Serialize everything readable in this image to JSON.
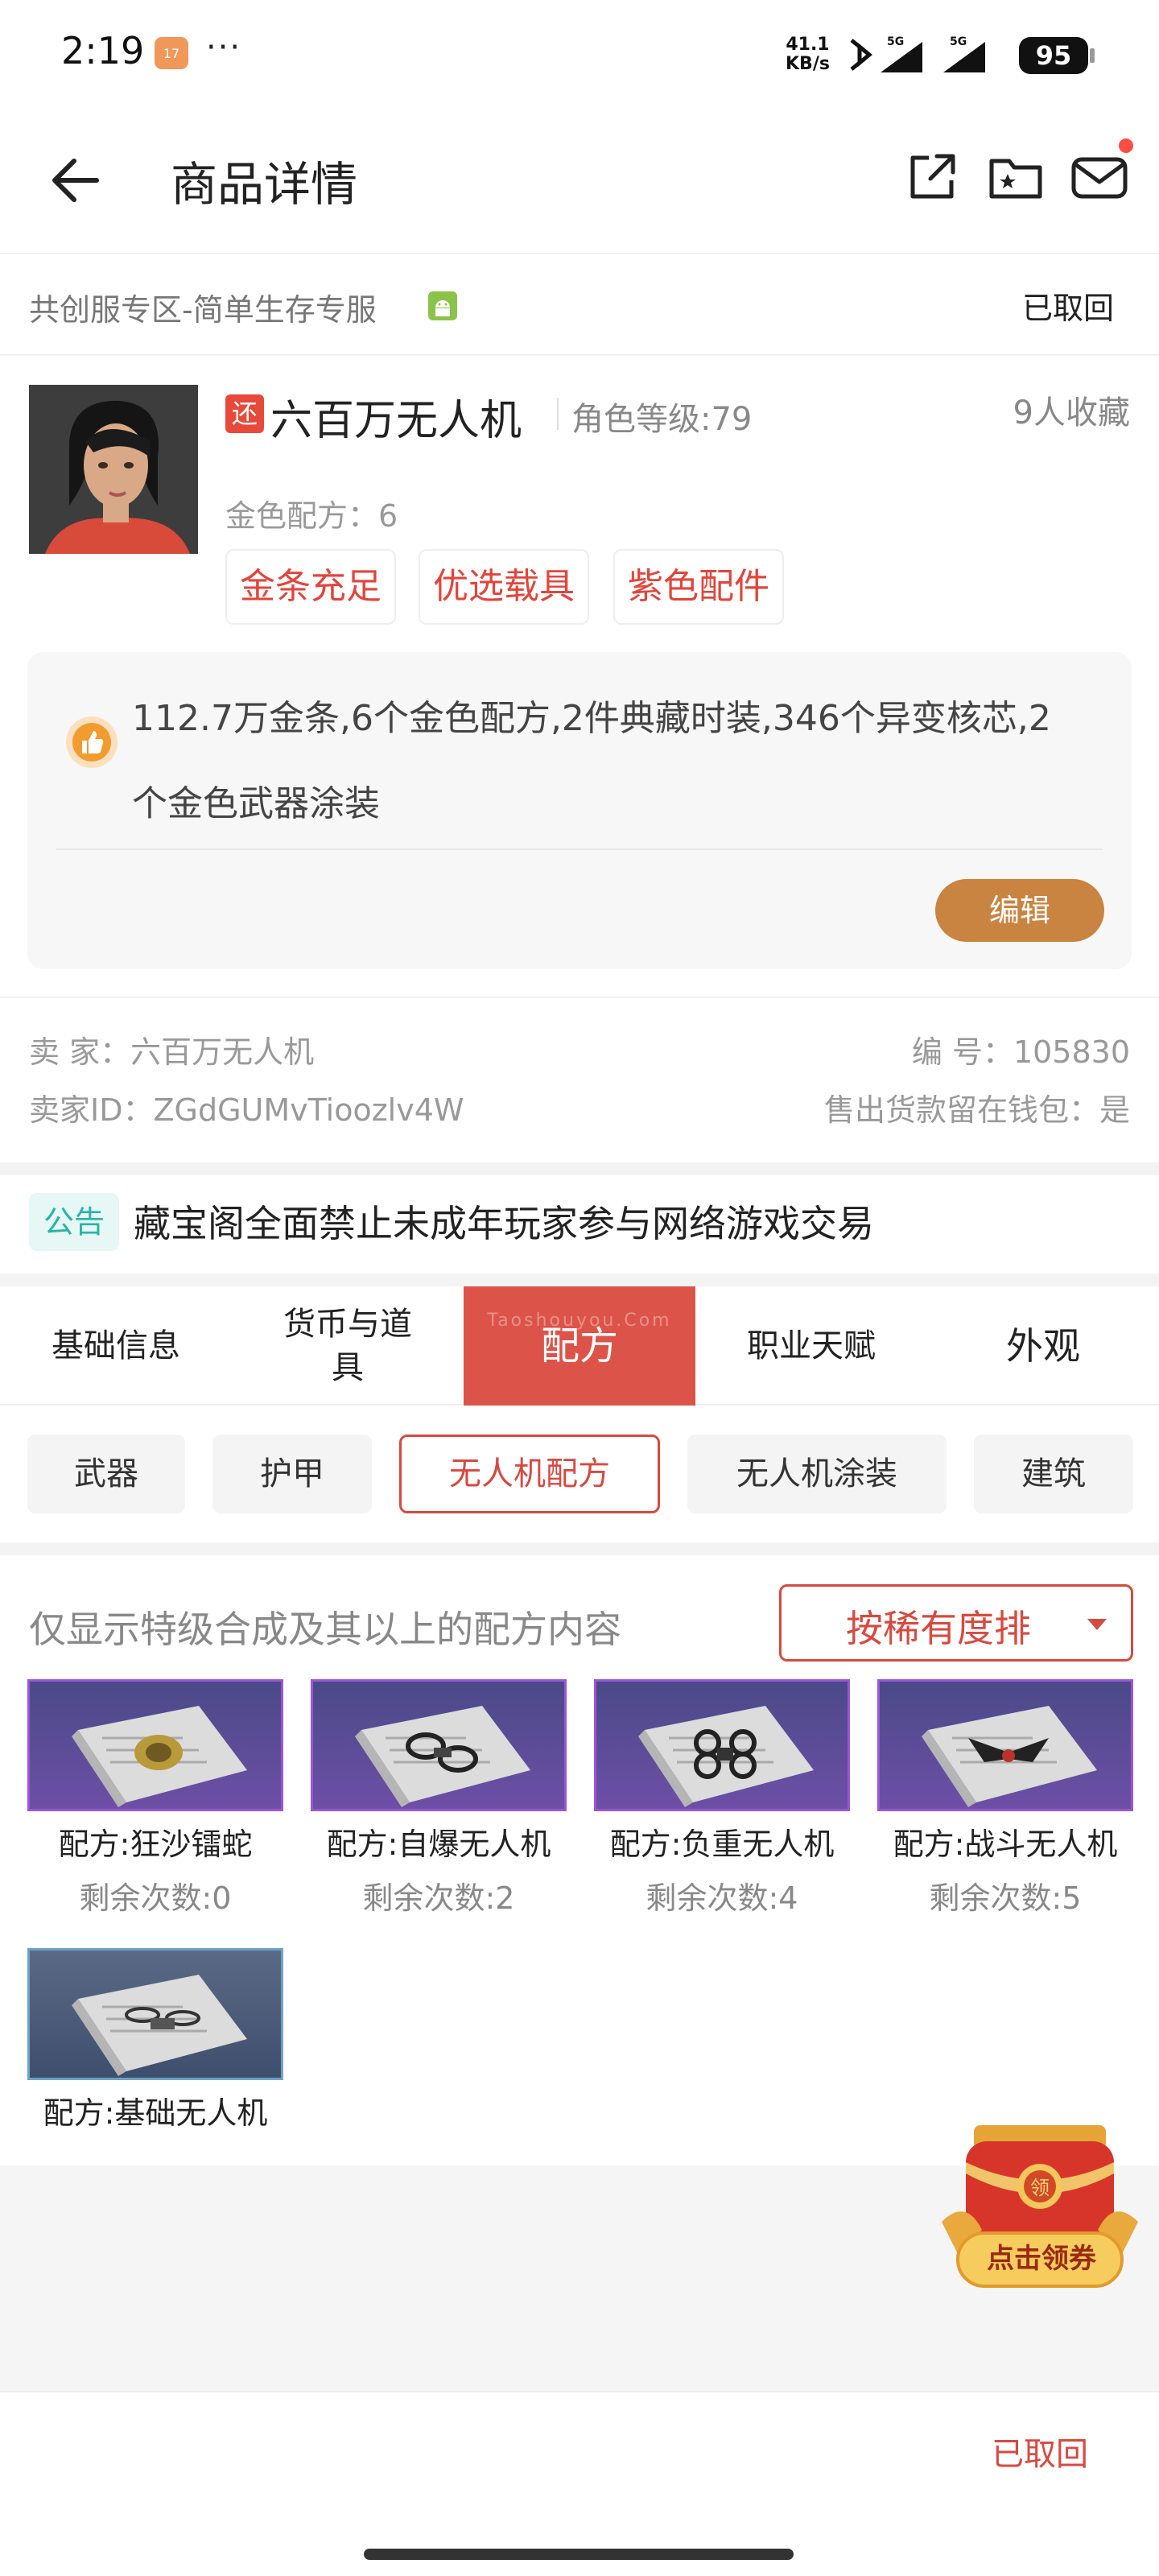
{
  "status_bar": {
    "time": "2:19",
    "calendar_badge": "17",
    "more": "···",
    "speed_value": "41.1",
    "speed_unit": "KB/s",
    "net1": "5G",
    "net2": "5G",
    "battery": "95"
  },
  "header": {
    "title": "商品详情",
    "icons": [
      "back-arrow-icon",
      "share-icon",
      "folder-star-icon",
      "mail-icon"
    ]
  },
  "server": {
    "name": "共创服专区-简单生存专服",
    "platform_icon": "android-icon",
    "status": "已取回"
  },
  "product": {
    "badge": "还",
    "title": "六百万无人机",
    "level": "角色等级:79",
    "favorites": "9人收藏",
    "gold_recipes": "金色配方：6",
    "tags": [
      "金条充足",
      "优选载具",
      "紫色配件"
    ]
  },
  "description": {
    "text": "112.7万金条,6个金色配方,2件典藏时装,346个异变核芯,2个金色武器涂装",
    "edit_label": "编辑"
  },
  "seller": {
    "seller_label": "卖  家：六百万无人机",
    "id_label": "卖家ID：ZGdGUMvTioozlv4W",
    "number_label": "编  号：105830",
    "wallet_label": "售出货款留在钱包：是"
  },
  "notice": {
    "tag": "公告",
    "text": "藏宝阁全面禁止未成年玩家参与网络游戏交易"
  },
  "tabs": [
    "基础信息",
    "货币与道具",
    "配方",
    "职业天赋",
    "外观"
  ],
  "tab_watermark": "Taoshouyou.Com",
  "active_tab": "配方",
  "subtabs": [
    "武器",
    "护甲",
    "无人机配方",
    "无人机涂装",
    "建筑"
  ],
  "active_subtab": "无人机配方",
  "recipes": {
    "filter_note": "仅显示特级合成及其以上的配方内容",
    "sort_label": "按稀有度排",
    "items": [
      {
        "name": "配方:狂沙镭蛇",
        "remaining": "剩余次数:0"
      },
      {
        "name": "配方:自爆无人机",
        "remaining": "剩余次数:2"
      },
      {
        "name": "配方:负重无人机",
        "remaining": "剩余次数:4"
      },
      {
        "name": "配方:战斗无人机",
        "remaining": "剩余次数:5"
      },
      {
        "name": "配方:基础无人机",
        "remaining": ""
      }
    ]
  },
  "promo": {
    "seal": "领",
    "label": "点击领券"
  },
  "bottom": {
    "status": "已取回"
  },
  "colors": {
    "accent_red": "#dc5449",
    "edit_brown": "#c98441",
    "purple_rarity": "#9a56d6",
    "blue_rarity": "#6ea2c4",
    "notice_teal": "#2bb3a5"
  }
}
